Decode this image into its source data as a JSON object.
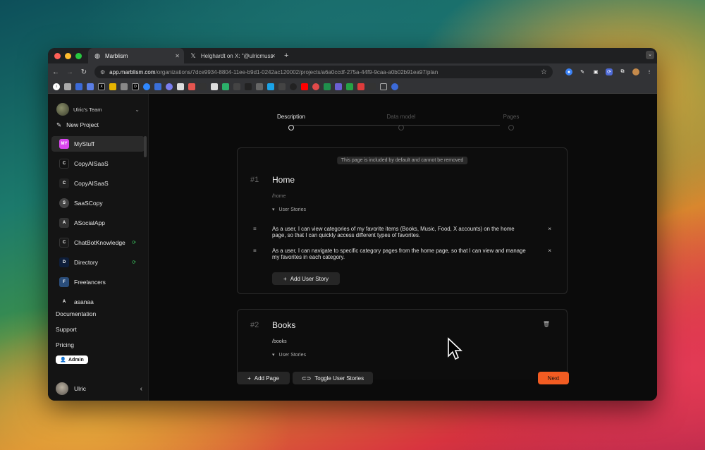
{
  "browser": {
    "tabs": [
      {
        "title": "Marblism",
        "favicon": "marblism-icon"
      },
      {
        "title": "Helghardt on X: \"@ulricmuss",
        "favicon": "x-icon"
      }
    ],
    "url_host": "app.marblism.com",
    "url_path": "/organizations/7dce9934-8804-11ee-b9d1-0242ac120002/projects/a6a0ccdf-275a-44f9-9caa-a0b02b91ea97/plan",
    "traffic_lights": [
      "#ff5f57",
      "#febc2e",
      "#28c840"
    ]
  },
  "sidebar": {
    "team": "Ulric's Team",
    "new_project": "New Project",
    "projects": [
      {
        "label": "MyStuff",
        "icon": "MY",
        "active": true,
        "color": "#d946ef"
      },
      {
        "label": "CopyAISaaS",
        "icon": "C"
      },
      {
        "label": "CopyAISaaS",
        "icon": "C"
      },
      {
        "label": "SaaSCopy",
        "icon": "S"
      },
      {
        "label": "ASocialApp",
        "icon": "A"
      },
      {
        "label": "ChatBotKnowledge",
        "icon": "C",
        "badge": true
      },
      {
        "label": "Directory",
        "icon": "D",
        "badge": true
      },
      {
        "label": "Freelancers",
        "icon": "F"
      },
      {
        "label": "asanaa",
        "icon": "A"
      }
    ],
    "links": [
      "Documentation",
      "Support",
      "Pricing"
    ],
    "admin_label": "Admin",
    "user_name": "Ulric"
  },
  "stepper": {
    "steps": [
      "Description",
      "Data model",
      "Pages"
    ]
  },
  "pages": [
    {
      "number": "#1",
      "title": "Home",
      "path": "/home",
      "notice": "This page is included by default and cannot be removed",
      "user_stories_label": "User Stories",
      "stories": [
        "As a user, I can view categories of my favorite items (Books, Music, Food, X accounts) on the home page, so that I can quickly access different types of favorites.",
        "As a user, I can navigate to specific category pages from the home page, so that I can view and manage my favorites in each category."
      ],
      "add_story_label": "Add User Story"
    },
    {
      "number": "#2",
      "title": "Books",
      "path": "/books",
      "user_stories_label": "User Stories"
    }
  ],
  "footer": {
    "add_page": "Add Page",
    "toggle_stories": "Toggle User Stories",
    "next": "Next"
  }
}
